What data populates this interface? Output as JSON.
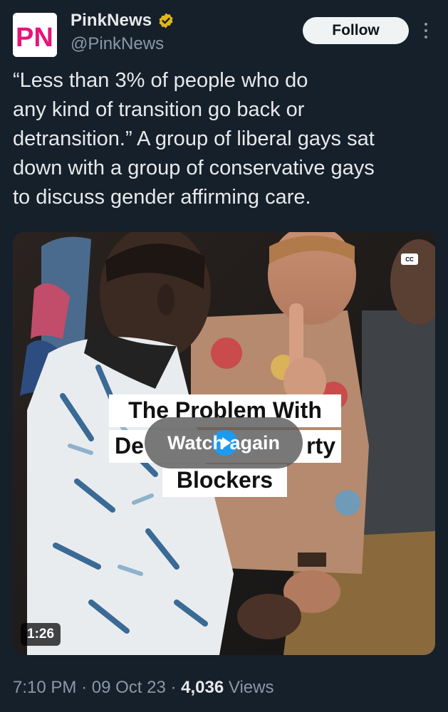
{
  "account": {
    "avatar_text": "PN",
    "display_name": "PinkNews",
    "handle": "@PinkNews",
    "verified_icon": "verified-badge-icon",
    "brand_colors": {
      "pink": "#e5157a",
      "dark": "#231f20"
    }
  },
  "actions": {
    "follow_label": "Follow",
    "more_icon": "more-options-icon"
  },
  "tweet": {
    "text": "“Less than 3% of people who do\nany kind of transition go back or\ndetransition.” A group of liberal gays sat\ndown with a group of conservative gays\nto discuss gender affirming care."
  },
  "video": {
    "cc_label": "CC",
    "caption_lines": [
      "The Problem With",
      "Detransition, Puberty",
      "Blockers"
    ],
    "caption_visible_fragments": {
      "left": "De",
      "right": "rty"
    },
    "watch_again_label": "Watch again",
    "play_icon": "play-icon",
    "duration": "1:26"
  },
  "meta": {
    "time": "7:10 PM",
    "separator": "·",
    "date": "09 Oct 23",
    "views_count": "4,036",
    "views_label": "Views"
  },
  "colors": {
    "background": "#15202b",
    "primary_text": "#e7e9ea",
    "secondary_text": "#8b98a5",
    "accent_blue": "#1d9bf0",
    "verified_gold": "#e2b719"
  }
}
